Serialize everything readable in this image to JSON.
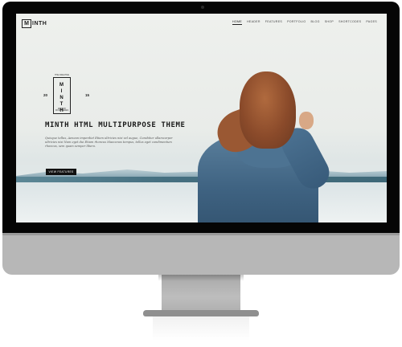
{
  "site": {
    "logo_mark": "M",
    "logo_rest": "INTH"
  },
  "nav": {
    "items": [
      {
        "label": "HOME",
        "active": true
      },
      {
        "label": "HEADER",
        "active": false
      },
      {
        "label": "FEATURES",
        "active": false
      },
      {
        "label": "PORTFOLIO",
        "active": false
      },
      {
        "label": "BLOG",
        "active": false
      },
      {
        "label": "SHOP",
        "active": false
      },
      {
        "label": "SHORTCODES",
        "active": false
      },
      {
        "label": "PAGES",
        "active": false
      }
    ]
  },
  "badge": {
    "top_text": "THE CREATIVE",
    "letters": [
      "M",
      "I",
      "N",
      "T",
      "H"
    ],
    "bottom_text": "MADE BY WOLFTHEMES",
    "year_left": "20",
    "year_right": "15"
  },
  "hero": {
    "title": "MINTH HTML MULTIPURPOSE THEME",
    "text": "Quisque tellus, Aenean imperdiet Etiam ultricies nisi vel augue, Curabitur ullamcorper ultricies nisi Nam eget dui Etiam rhoncus Maecenas tempus, tellus eget condimentum rhoncus, sem quam semper libero.",
    "cta_label": "VIEW FEATURES"
  }
}
